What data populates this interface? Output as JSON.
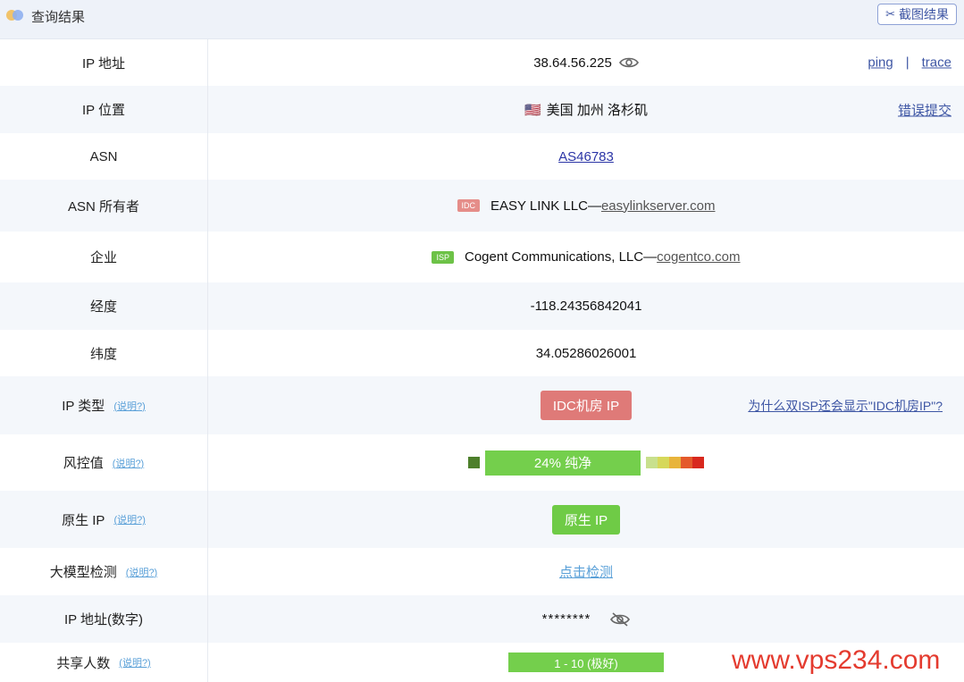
{
  "header": {
    "title": "查询结果",
    "screenshot_label": "截图结果"
  },
  "rows": {
    "ip": {
      "label": "IP 地址",
      "value": "38.64.56.225",
      "ping": "ping",
      "sep": "|",
      "trace": "trace"
    },
    "location": {
      "label": "IP 位置",
      "flag": "🇺🇸",
      "value": "美国 加州 洛杉矶",
      "report": "错误提交"
    },
    "asn": {
      "label": "ASN",
      "value": "AS46783"
    },
    "asn_owner": {
      "label": "ASN 所有者",
      "tag": "IDC",
      "name": "EASY LINK LLC—",
      "domain": "easylinkserver.com"
    },
    "company": {
      "label": "企业",
      "tag": "ISP",
      "name": "Cogent Communications, LLC—",
      "domain": "cogentco.com"
    },
    "longitude": {
      "label": "经度",
      "value": "-118.24356842041"
    },
    "latitude": {
      "label": "纬度",
      "value": "34.05286026001"
    },
    "ip_type": {
      "label": "IP 类型",
      "explain": "(说明?)",
      "value": "IDC机房 IP",
      "help": "为什么双ISP还会显示\"IDC机房IP\"?"
    },
    "risk": {
      "label": "风控值",
      "explain": "(说明?)",
      "value": "24%  纯净",
      "level": 0.24
    },
    "native": {
      "label": "原生 IP",
      "explain": "(说明?)",
      "value": "原生 IP"
    },
    "llm": {
      "label": "大模型检测",
      "explain": "(说明?)",
      "value": "点击检测"
    },
    "ip_numeric": {
      "label": "IP 地址(数字)",
      "value": "********"
    },
    "shared": {
      "label": "共享人数",
      "explain": "(说明?)",
      "value": "1 - 10 (极好)"
    }
  },
  "colors": {
    "risk_scale": [
      "#c8e08d",
      "#d6d85a",
      "#e8b43b",
      "#e45a2b",
      "#d8281e"
    ]
  },
  "watermark": "www.vps234.com"
}
